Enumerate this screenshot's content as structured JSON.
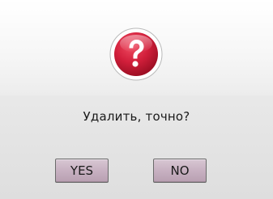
{
  "dialog": {
    "message": "Удалить, точно?",
    "icon": "question-icon",
    "yes_label": "YES",
    "no_label": "NO"
  },
  "colors": {
    "icon_red": "#c8102e",
    "button_fill": "#c9b3c3"
  }
}
